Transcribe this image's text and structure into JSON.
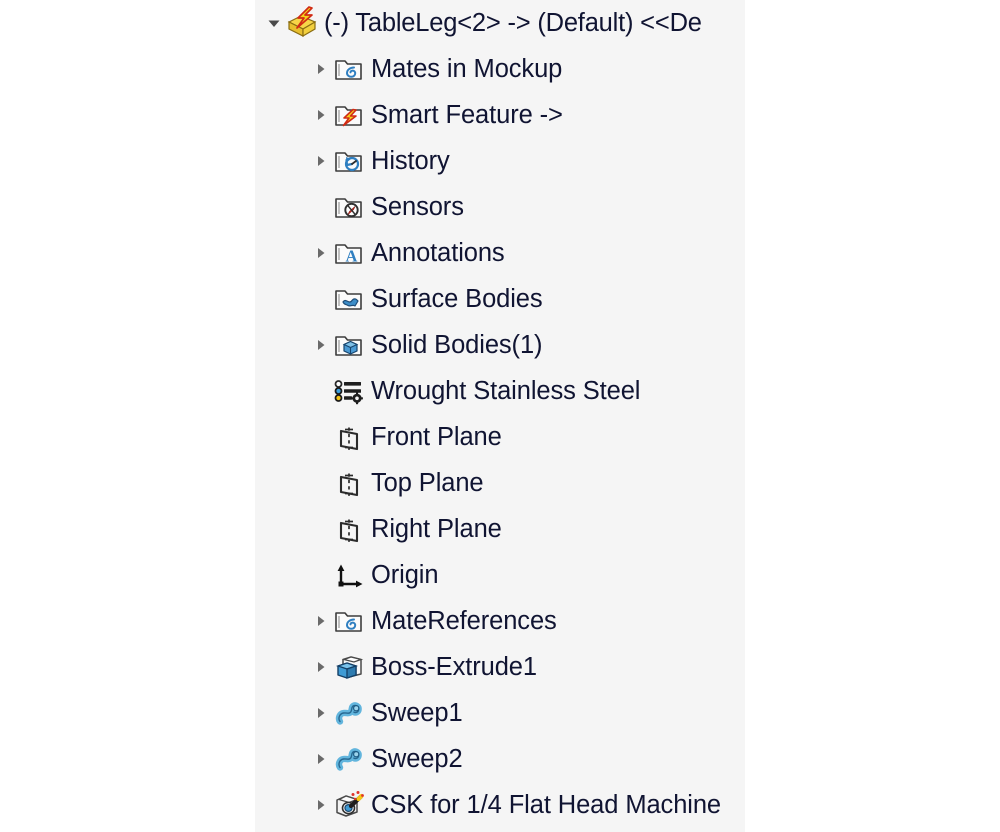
{
  "panel": {
    "name": "solidworks-feature-tree",
    "background_color": "#f5f5f5",
    "outer_background_color": "#ffffff",
    "text_color": "#101432"
  },
  "tree": {
    "root": {
      "label": "(-) TableLeg<2> -> (Default) <<De",
      "icon": "part-with-lightning-icon",
      "expanded": true,
      "has_expander": true,
      "indent": 0
    },
    "items": [
      {
        "label": "Mates in Mockup",
        "icon": "folder-mates-icon",
        "has_expander": true,
        "expanded": false,
        "indent": 1
      },
      {
        "label": "Smart Feature ->",
        "icon": "folder-lightning-icon",
        "has_expander": true,
        "expanded": false,
        "indent": 1
      },
      {
        "label": "History",
        "icon": "folder-history-icon",
        "has_expander": true,
        "expanded": false,
        "indent": 1
      },
      {
        "label": "Sensors",
        "icon": "folder-sensors-icon",
        "has_expander": false,
        "expanded": false,
        "indent": 1
      },
      {
        "label": "Annotations",
        "icon": "folder-annotations-icon",
        "has_expander": true,
        "expanded": false,
        "indent": 1
      },
      {
        "label": "Surface Bodies",
        "icon": "folder-surface-bodies-icon",
        "has_expander": false,
        "expanded": false,
        "indent": 1
      },
      {
        "label": "Solid Bodies(1)",
        "icon": "folder-solid-bodies-icon",
        "has_expander": true,
        "expanded": false,
        "indent": 1
      },
      {
        "label": "Wrought Stainless Steel",
        "icon": "material-icon",
        "has_expander": false,
        "expanded": false,
        "indent": 1
      },
      {
        "label": "Front Plane",
        "icon": "plane-icon",
        "has_expander": false,
        "expanded": false,
        "indent": 1
      },
      {
        "label": "Top Plane",
        "icon": "plane-icon",
        "has_expander": false,
        "expanded": false,
        "indent": 1
      },
      {
        "label": "Right Plane",
        "icon": "plane-icon",
        "has_expander": false,
        "expanded": false,
        "indent": 1
      },
      {
        "label": "Origin",
        "icon": "origin-axes-icon",
        "has_expander": false,
        "expanded": false,
        "indent": 1
      },
      {
        "label": "MateReferences",
        "icon": "folder-mates-icon",
        "has_expander": true,
        "expanded": false,
        "indent": 1
      },
      {
        "label": "Boss-Extrude1",
        "icon": "boss-extrude-icon",
        "has_expander": true,
        "expanded": false,
        "indent": 1
      },
      {
        "label": "Sweep1",
        "icon": "sweep-icon",
        "has_expander": true,
        "expanded": false,
        "indent": 1
      },
      {
        "label": "Sweep2",
        "icon": "sweep-icon",
        "has_expander": true,
        "expanded": false,
        "indent": 1
      },
      {
        "label": "CSK for 1/4 Flat Head Machine",
        "icon": "hole-wizard-icon",
        "has_expander": true,
        "expanded": false,
        "indent": 1
      }
    ]
  }
}
